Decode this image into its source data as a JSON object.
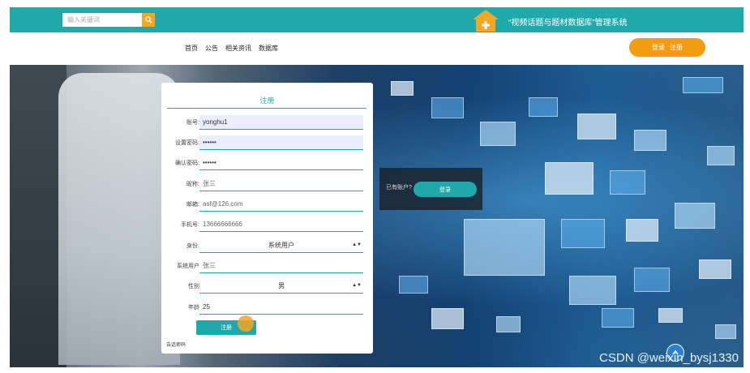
{
  "header": {
    "search_placeholder": "输入关键词",
    "search_icon": "search-icon",
    "logo_icon": "house-plus-icon",
    "site_title": "“视频话题与题材数据库”管理系统"
  },
  "nav": {
    "items": [
      {
        "label": "首页"
      },
      {
        "label": "公告"
      },
      {
        "label": "相关资讯"
      },
      {
        "label": "数据库"
      }
    ],
    "login_label": "登录",
    "register_label": "注册"
  },
  "form": {
    "title": "注册",
    "fields": [
      {
        "label": "账号:",
        "value": "yonghu1"
      },
      {
        "label": "设置密码:",
        "value": "••••••"
      },
      {
        "label": "确认密码:",
        "value": "••••••"
      },
      {
        "label": "昵称:",
        "value": "张三"
      },
      {
        "label": "邮箱:",
        "value": "asf@126.com"
      },
      {
        "label": "手机号:",
        "value": "13666666666"
      },
      {
        "label": "身份:",
        "value": "系统用户"
      },
      {
        "label": "系统用户",
        "value": "张三"
      },
      {
        "label": "性别",
        "value": "男"
      },
      {
        "label": "年龄",
        "value": "25"
      }
    ],
    "submit_label": "注册",
    "footer_text": "告话密码"
  },
  "login_prompt": {
    "hint": "已有账户?",
    "button_label": "登录"
  },
  "watermark": "CSDN @weixin_bysj1330",
  "colors": {
    "teal": "#1fa9ab",
    "orange": "#f39c12"
  }
}
